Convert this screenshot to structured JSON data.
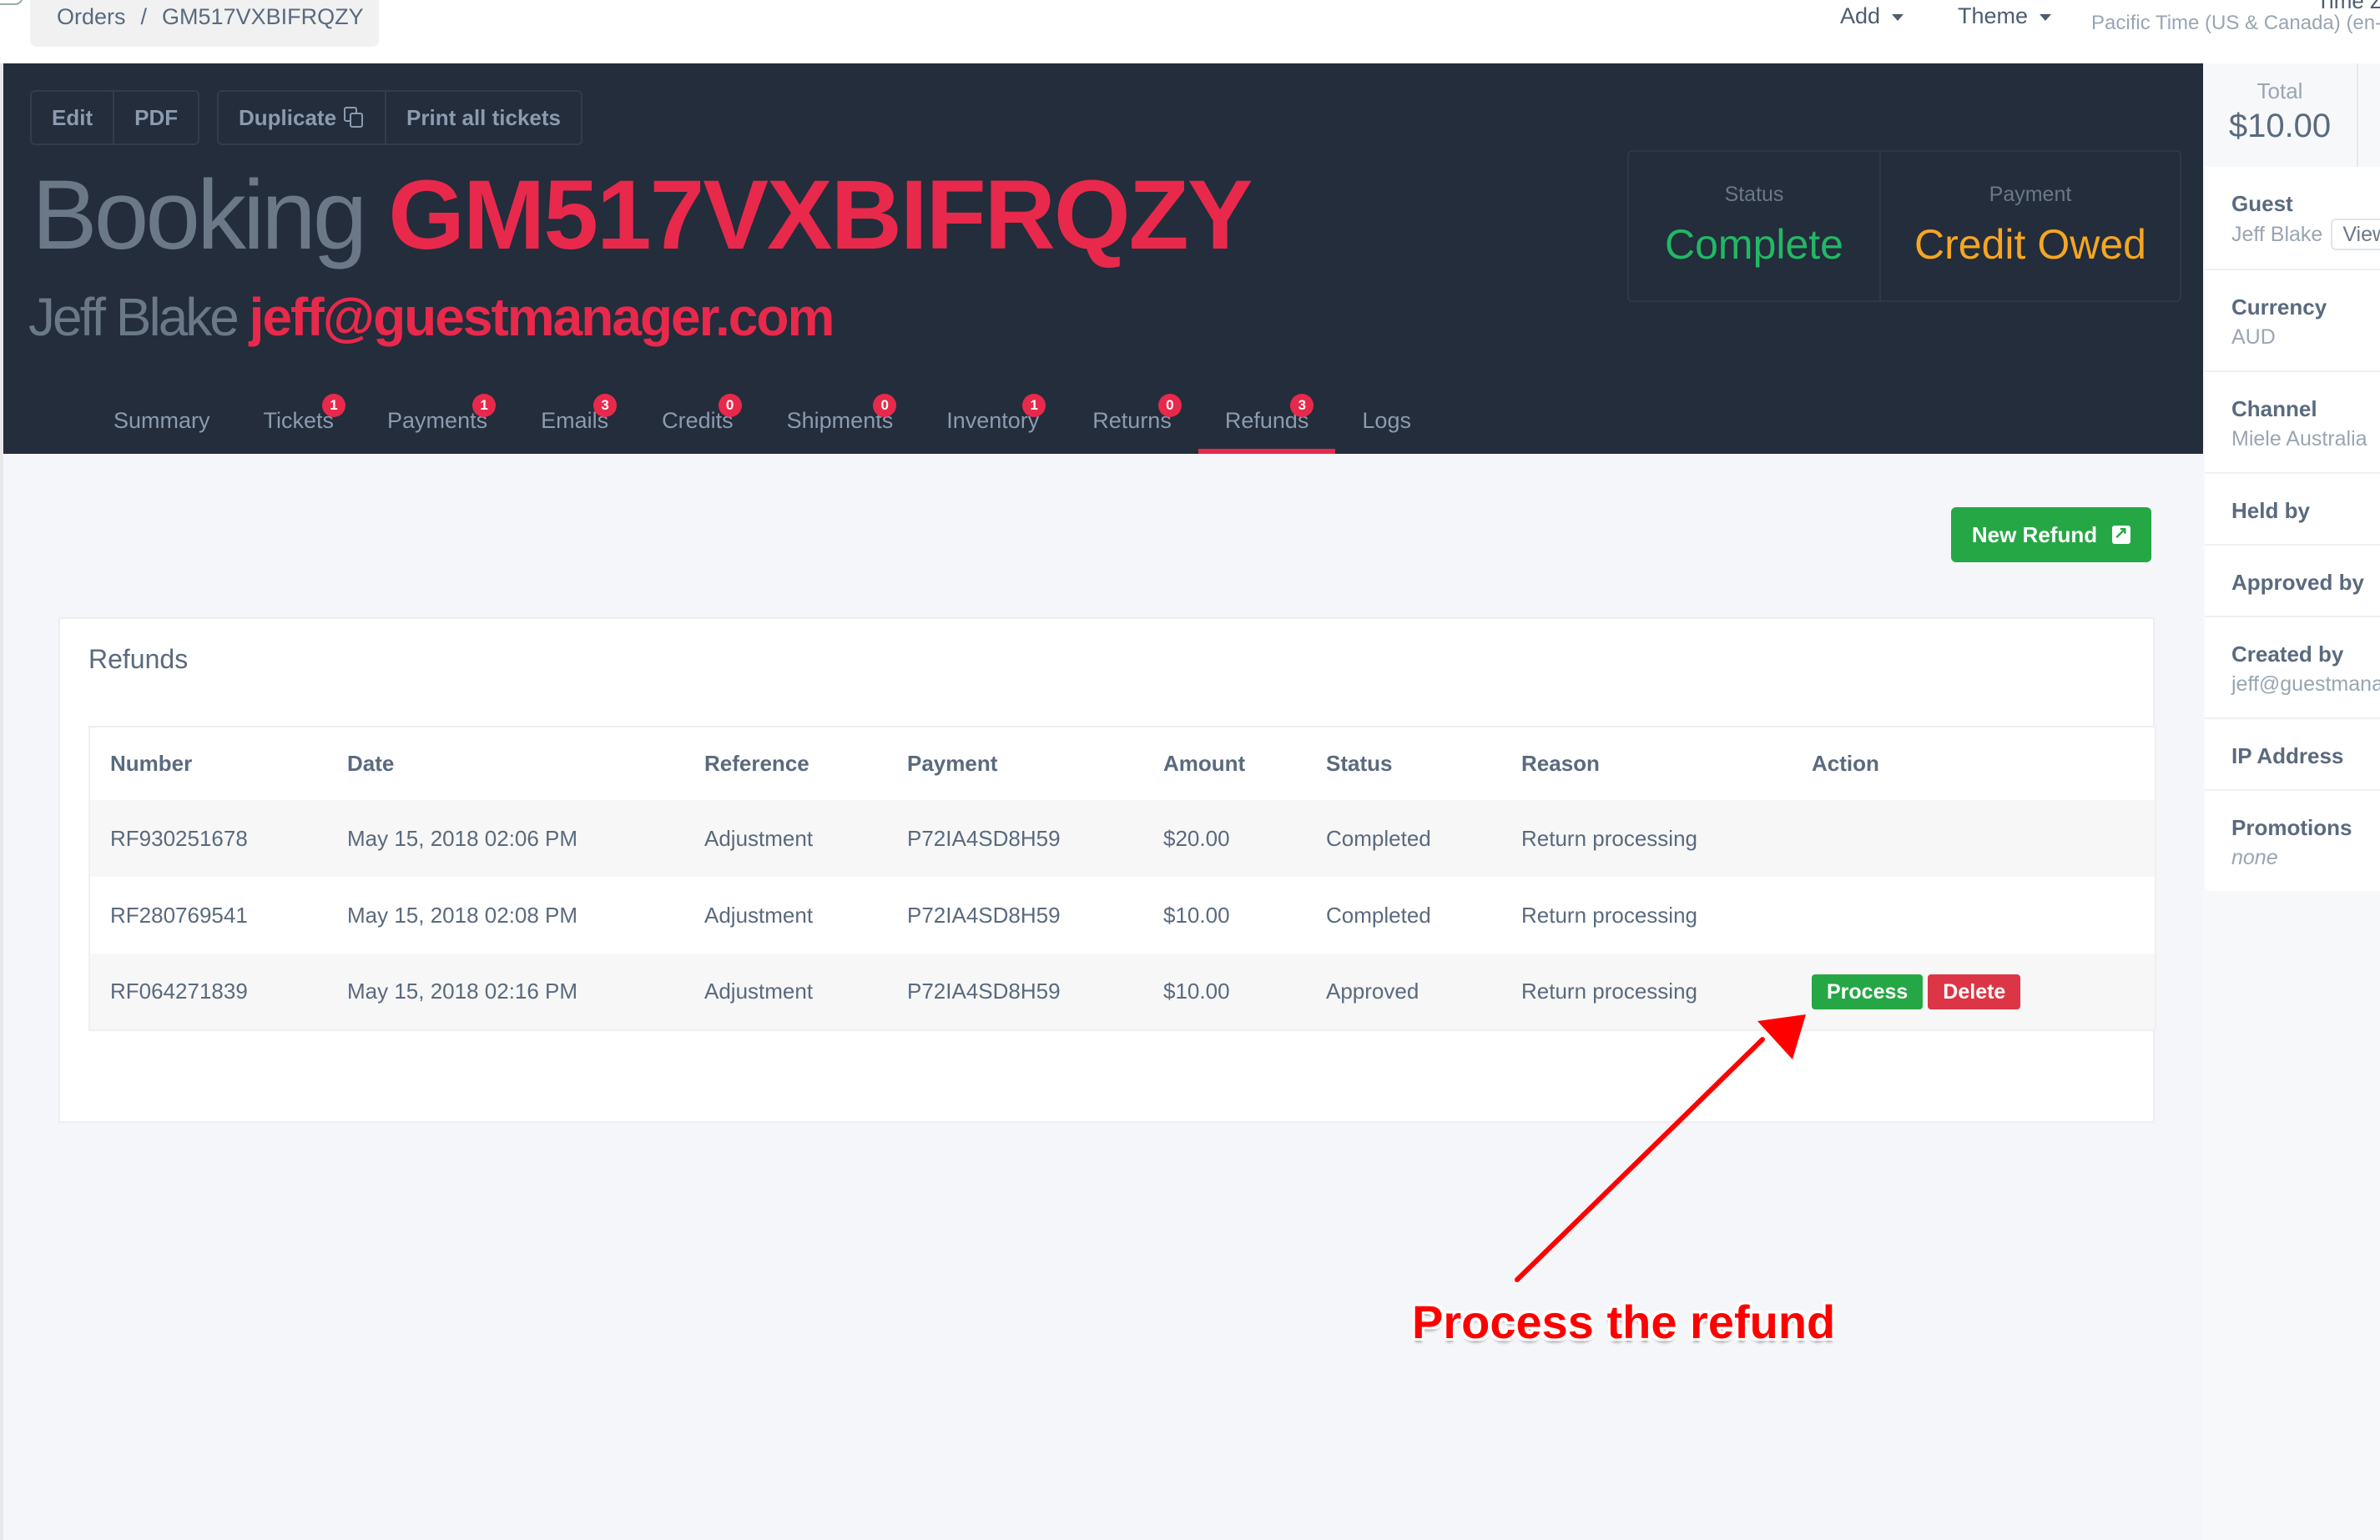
{
  "topbar": {
    "breadcrumb": [
      "Orders",
      "GM517VXBIFRQZY"
    ],
    "breadcrumb_sep": "/",
    "nav": [
      {
        "label": "Add"
      },
      {
        "label": "Theme"
      }
    ],
    "timezone_label": "Time Z",
    "timezone_value": "Pacific Time (US & Canada) (en-"
  },
  "header": {
    "buttons_group1": [
      "Edit",
      "PDF"
    ],
    "buttons_group2": [
      "Duplicate",
      "Print all tickets"
    ],
    "booking_label": "Booking",
    "booking_code": "GM517VXBIFRQZY",
    "guest_name": "Jeff Blake",
    "guest_email": "jeff@guestmanager.com",
    "status": {
      "caption": "Status",
      "value": "Complete",
      "color": "#22b865"
    },
    "payment": {
      "caption": "Payment",
      "value": "Credit Owed",
      "color": "#f5a623"
    },
    "accent": "#e8294b"
  },
  "tabs": [
    {
      "label": "Summary",
      "badge": null
    },
    {
      "label": "Tickets",
      "badge": "1"
    },
    {
      "label": "Payments",
      "badge": "1"
    },
    {
      "label": "Emails",
      "badge": "3"
    },
    {
      "label": "Credits",
      "badge": "0"
    },
    {
      "label": "Shipments",
      "badge": "0"
    },
    {
      "label": "Inventory",
      "badge": "1"
    },
    {
      "label": "Returns",
      "badge": "0"
    },
    {
      "label": "Refunds",
      "badge": "3",
      "active": true
    },
    {
      "label": "Logs",
      "badge": null
    }
  ],
  "main": {
    "new_refund_label": "New Refund",
    "card_title": "Refunds",
    "columns": [
      "Number",
      "Date",
      "Reference",
      "Payment",
      "Amount",
      "Status",
      "Reason",
      "Action"
    ],
    "rows": [
      {
        "number": "RF930251678",
        "date": "May 15, 2018 02:06 PM",
        "reference": "Adjustment",
        "payment": "P72IA4SD8H59",
        "amount": "$20.00",
        "status": "Completed",
        "reason": "Return processing",
        "actions": []
      },
      {
        "number": "RF280769541",
        "date": "May 15, 2018 02:08 PM",
        "reference": "Adjustment",
        "payment": "P72IA4SD8H59",
        "amount": "$10.00",
        "status": "Completed",
        "reason": "Return processing",
        "actions": []
      },
      {
        "number": "RF064271839",
        "date": "May 15, 2018 02:16 PM",
        "reference": "Adjustment",
        "payment": "P72IA4SD8H59",
        "amount": "$10.00",
        "status": "Approved",
        "reason": "Return processing",
        "actions": [
          "Process",
          "Delete"
        ]
      }
    ],
    "action_colors": {
      "Process": "#26a745",
      "Delete": "#dc3545"
    }
  },
  "sidebar": {
    "total_caption": "Total",
    "total_value": "$10.00",
    "items": [
      {
        "key": "Guest",
        "value": "Jeff Blake",
        "button": "View"
      },
      {
        "key": "Currency",
        "value": "AUD"
      },
      {
        "key": "Channel",
        "value": "Miele Australia"
      },
      {
        "key": "Held by",
        "value": ""
      },
      {
        "key": "Approved by",
        "value": ""
      },
      {
        "key": "Created by",
        "value": "jeff@guestmanager.com"
      },
      {
        "key": "IP Address",
        "value": ""
      },
      {
        "key": "Promotions",
        "value": "none",
        "italic": true
      }
    ]
  },
  "annotation": {
    "text": "Process the refund",
    "color": "#ff0000"
  }
}
